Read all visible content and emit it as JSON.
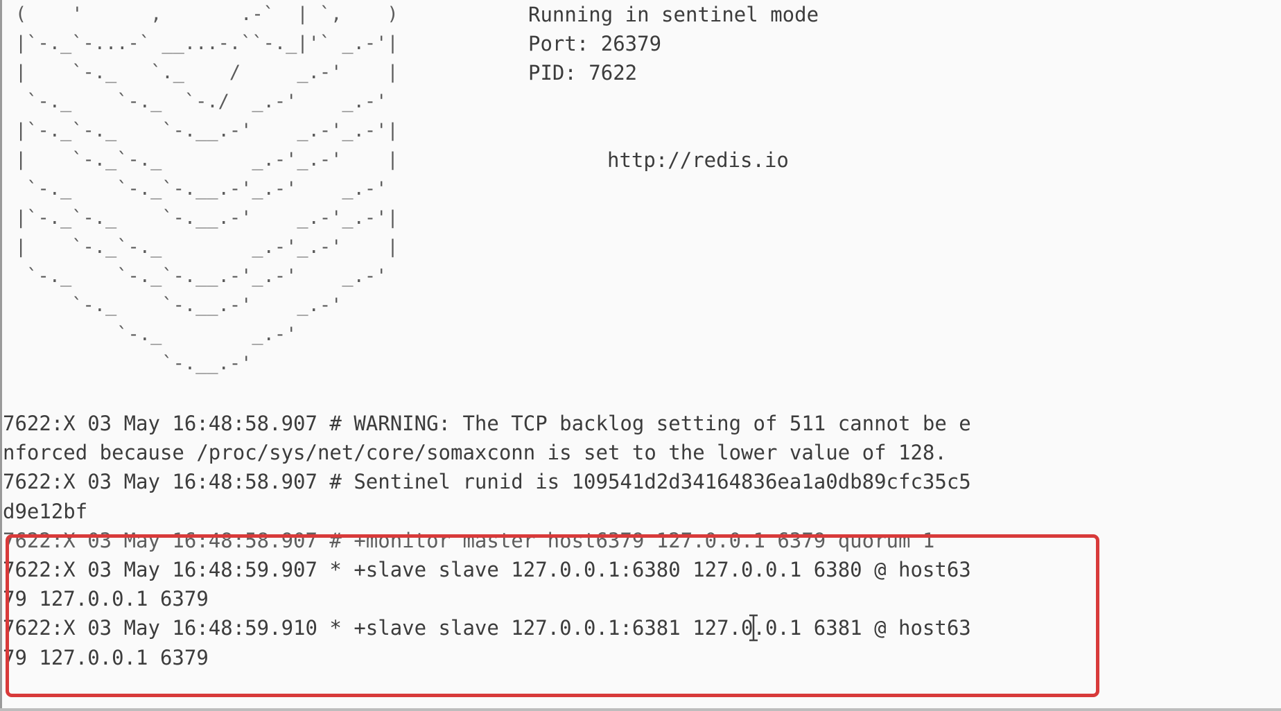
{
  "terminal": {
    "ascii_logo": "(    '      ,       .-`  | `,    )\n|`-._`-...-` __...-.``-._|'` _.-'|\n|    `-._   `._    /     _.-'    |\n `-._    `-._  `-./  _.-'    _.-'\n|`-._`-._    `-.__.-'    _.-'_.-'|\n|    `-._`-._        _.-'_.-'    |\n `-._    `-._`-.__.-'_.-'    _.-'\n|`-._`-._    `-.__.-'    _.-'_.-'|\n|    `-._`-._        _.-'_.-'    |\n `-._    `-._`-.__.-'_.-'    _.-'\n     `-._    `-.__.-'    _.-'\n         `-._        _.-'\n             `-.__.-'",
    "info": {
      "mode": "Running in sentinel mode",
      "port": "Port: 26379",
      "pid": "PID: 7622",
      "url": "http://redis.io"
    },
    "log_lines": [
      "7622:X 03 May 16:48:58.907 # WARNING: The TCP backlog setting of 511 cannot be e",
      "nforced because /proc/sys/net/core/somaxconn is set to the lower value of 128.",
      "7622:X 03 May 16:48:58.907 # Sentinel runid is 109541d2d34164836ea1a0db89cfc35c5",
      "d9e12bf",
      "7622:X 03 May 16:48:58.907 # +monitor master host6379 127.0.0.1 6379 quorum 1",
      "7622:X 03 May 16:48:59.907 * +slave slave 127.0.0.1:6380 127.0.0.1 6380 @ host63",
      "79 127.0.0.1 6379",
      "7622:X 03 May 16:48:59.910 * +slave slave 127.0.0.1:6381 127.0.0.1 6381 @ host63",
      "79 127.0.0.1 6379"
    ]
  },
  "colors": {
    "background": "#fafafa",
    "text": "#3c3c3c",
    "highlight_border": "#d83a3a"
  },
  "icons": {
    "cursor": "i-beam-cursor-icon"
  }
}
